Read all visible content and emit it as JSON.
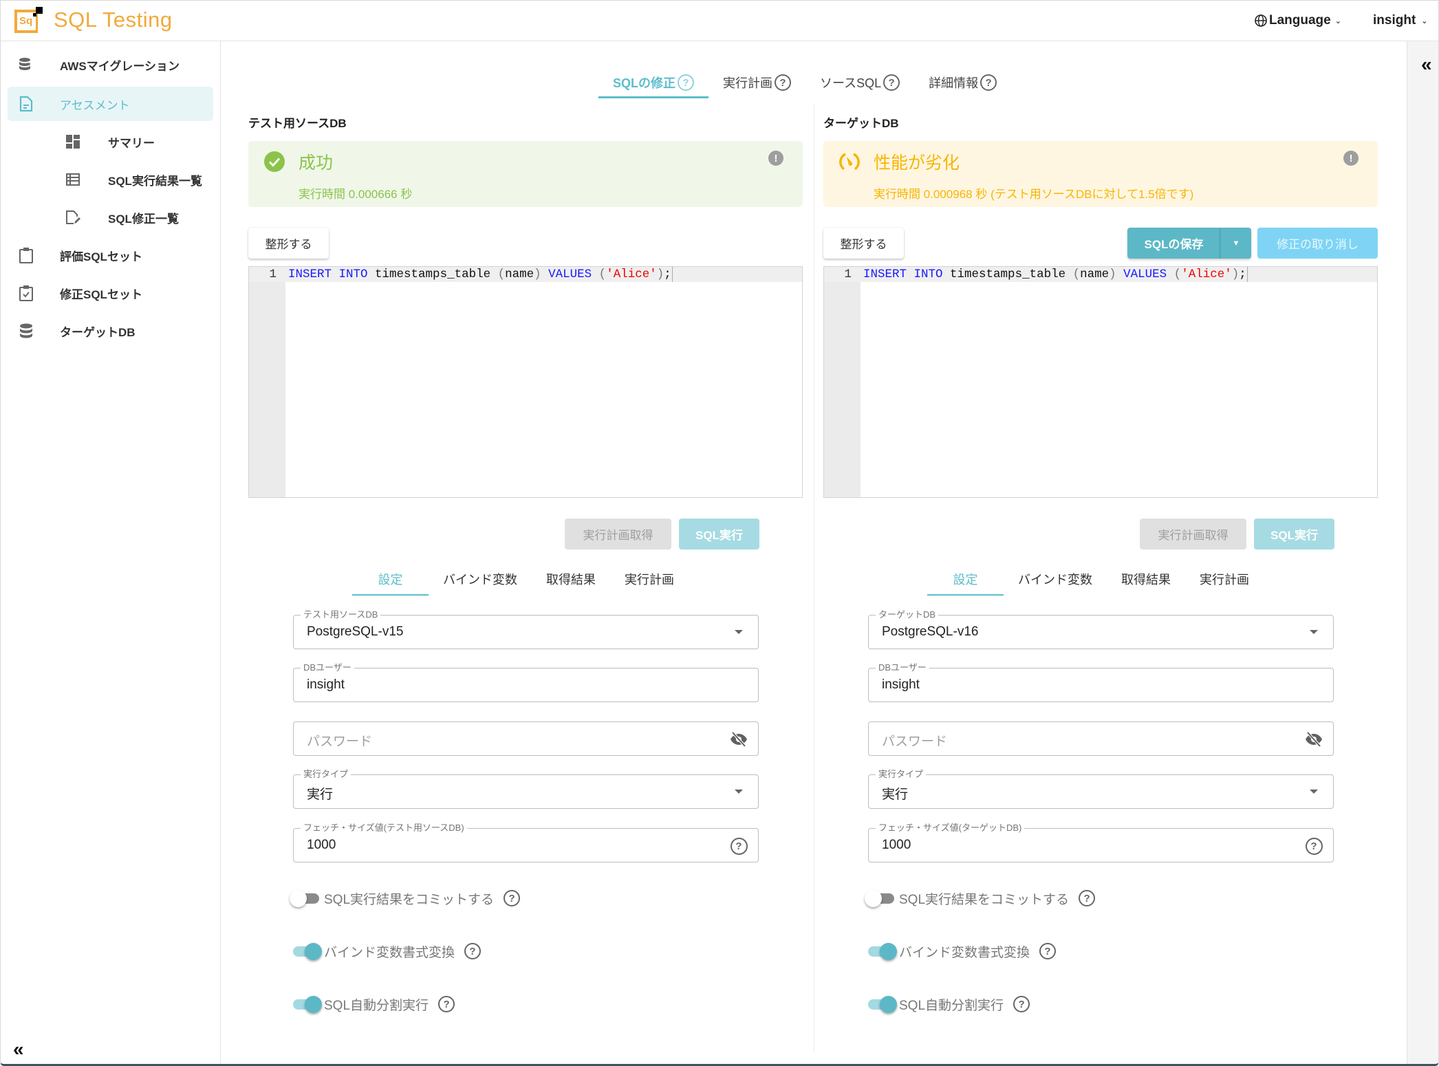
{
  "header": {
    "app_title": "SQL Testing",
    "logo_text": "Sq",
    "language_label": "Language",
    "user_label": "insight"
  },
  "sidebar": {
    "items": [
      {
        "label": "AWSマイグレーション",
        "icon": "database-migrate-icon",
        "active": false,
        "sub": false
      },
      {
        "label": "アセスメント",
        "icon": "document-icon",
        "active": true,
        "sub": false
      },
      {
        "label": "サマリー",
        "icon": "dashboard-icon",
        "active": false,
        "sub": true
      },
      {
        "label": "SQL実行結果一覧",
        "icon": "list-icon",
        "active": false,
        "sub": true
      },
      {
        "label": "SQL修正一覧",
        "icon": "edit-document-icon",
        "active": false,
        "sub": true
      },
      {
        "label": "評価SQLセット",
        "icon": "clipboard-icon",
        "active": false,
        "sub": false
      },
      {
        "label": "修正SQLセット",
        "icon": "clipboard-check-icon",
        "active": false,
        "sub": false
      },
      {
        "label": "ターゲットDB",
        "icon": "database-icon",
        "active": false,
        "sub": false
      }
    ],
    "collapse_icon": "«"
  },
  "rail": {
    "collapse_icon": "«"
  },
  "main_tabs": [
    {
      "label": "SQLの修正",
      "active": true
    },
    {
      "label": "実行計画",
      "active": false
    },
    {
      "label": "ソースSQL",
      "active": false
    },
    {
      "label": "詳細情報",
      "active": false
    }
  ],
  "colors": {
    "accent": "#5cbdcb",
    "success": "#8bc34a",
    "warning": "#f7b500",
    "brand": "#f2a93b"
  },
  "source": {
    "title": "テスト用ソースDB",
    "status": {
      "type": "success",
      "title": "成功",
      "time": "実行時間 0.000666 秒"
    },
    "format_button": "整形する",
    "editor": {
      "line_number": "1",
      "tokens": [
        {
          "t": "INSERT",
          "c": "kw"
        },
        {
          "t": " ",
          "c": ""
        },
        {
          "t": "INTO",
          "c": "kw"
        },
        {
          "t": " timestamps_table ",
          "c": ""
        },
        {
          "t": "(",
          "c": "paren"
        },
        {
          "t": "name",
          "c": ""
        },
        {
          "t": ")",
          "c": "paren"
        },
        {
          "t": " ",
          "c": ""
        },
        {
          "t": "VALUES",
          "c": "kw"
        },
        {
          "t": " ",
          "c": ""
        },
        {
          "t": "(",
          "c": "paren"
        },
        {
          "t": "'Alice'",
          "c": "str"
        },
        {
          "t": ")",
          "c": "paren"
        },
        {
          "t": ";",
          "c": ""
        }
      ]
    },
    "plan_button": "実行計画取得",
    "run_button": "SQL実行",
    "sub_tabs": [
      {
        "label": "設定",
        "active": true
      },
      {
        "label": "バインド変数",
        "active": false
      },
      {
        "label": "取得結果",
        "active": false
      },
      {
        "label": "実行計画",
        "active": false
      }
    ],
    "fields": {
      "db": {
        "label": "テスト用ソースDB",
        "value": "PostgreSQL-v15"
      },
      "user": {
        "label": "DBユーザー",
        "value": "insight"
      },
      "password": {
        "placeholder": "パスワード"
      },
      "exec_type": {
        "label": "実行タイプ",
        "value": "実行"
      },
      "fetch_size": {
        "label": "フェッチ・サイズ値(テスト用ソースDB)",
        "value": "1000"
      }
    },
    "toggles": [
      {
        "label": "SQL実行結果をコミットする",
        "on": false
      },
      {
        "label": "バインド変数書式変換",
        "on": true
      },
      {
        "label": "SQL自動分割実行",
        "on": true
      }
    ]
  },
  "target": {
    "title": "ターゲットDB",
    "status": {
      "type": "warning",
      "title": "性能が劣化",
      "time": "実行時間 0.000968 秒 (テスト用ソースDBに対して1.5倍です)"
    },
    "format_button": "整形する",
    "save_button": "SQLの保存",
    "revert_button": "修正の取り消し",
    "editor": {
      "line_number": "1",
      "tokens": [
        {
          "t": "INSERT",
          "c": "kw"
        },
        {
          "t": " ",
          "c": ""
        },
        {
          "t": "INTO",
          "c": "kw"
        },
        {
          "t": " timestamps_table ",
          "c": ""
        },
        {
          "t": "(",
          "c": "paren"
        },
        {
          "t": "name",
          "c": ""
        },
        {
          "t": ")",
          "c": "paren"
        },
        {
          "t": " ",
          "c": ""
        },
        {
          "t": "VALUES",
          "c": "kw"
        },
        {
          "t": " ",
          "c": ""
        },
        {
          "t": "(",
          "c": "paren"
        },
        {
          "t": "'Alice'",
          "c": "str"
        },
        {
          "t": ")",
          "c": "paren"
        },
        {
          "t": ";",
          "c": ""
        }
      ]
    },
    "plan_button": "実行計画取得",
    "run_button": "SQL実行",
    "sub_tabs": [
      {
        "label": "設定",
        "active": true
      },
      {
        "label": "バインド変数",
        "active": false
      },
      {
        "label": "取得結果",
        "active": false
      },
      {
        "label": "実行計画",
        "active": false
      }
    ],
    "fields": {
      "db": {
        "label": "ターゲットDB",
        "value": "PostgreSQL-v16"
      },
      "user": {
        "label": "DBユーザー",
        "value": "insight"
      },
      "password": {
        "placeholder": "パスワード"
      },
      "exec_type": {
        "label": "実行タイプ",
        "value": "実行"
      },
      "fetch_size": {
        "label": "フェッチ・サイズ値(ターゲットDB)",
        "value": "1000"
      }
    },
    "toggles": [
      {
        "label": "SQL実行結果をコミットする",
        "on": false
      },
      {
        "label": "バインド変数書式変換",
        "on": true
      },
      {
        "label": "SQL自動分割実行",
        "on": true
      }
    ]
  }
}
